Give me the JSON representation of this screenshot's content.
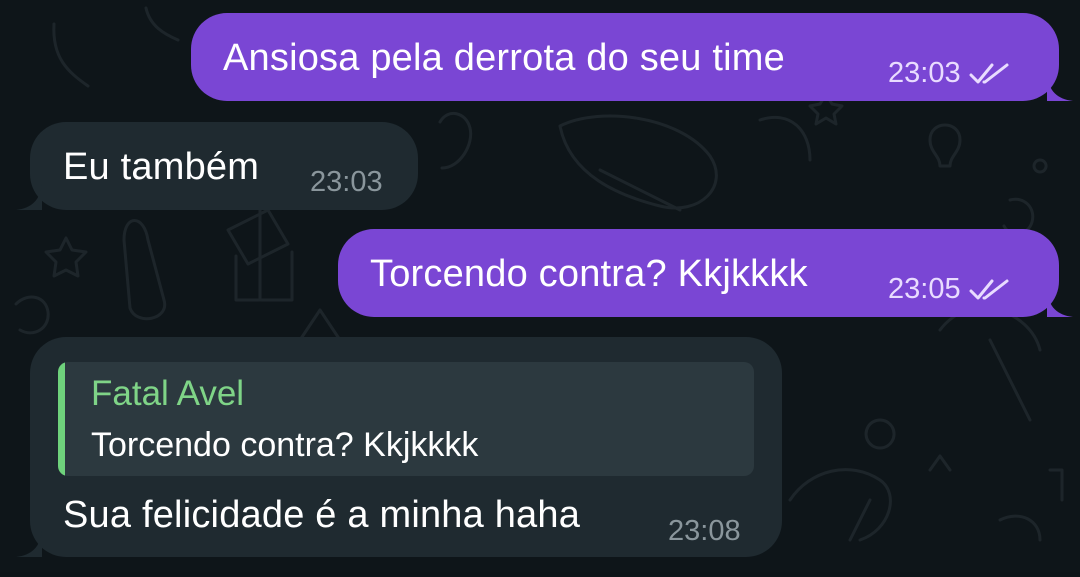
{
  "chat": {
    "messages": [
      {
        "direction": "outgoing",
        "text": "Ansiosa pela derrota do seu time",
        "time": "23:03",
        "status_icon": "double-check-icon"
      },
      {
        "direction": "incoming",
        "text": "Eu também",
        "time": "23:03"
      },
      {
        "direction": "outgoing",
        "text": "Torcendo contra? Kkjkkkk",
        "time": "23:05",
        "status_icon": "double-check-icon"
      },
      {
        "direction": "incoming",
        "reply_to": {
          "name": "Fatal Avel",
          "text": "Torcendo contra? Kkjkkkk"
        },
        "text": "Sua felicidade é a minha haha",
        "time": "23:08"
      }
    ]
  },
  "colors": {
    "background": "#0e1519",
    "outgoing_bubble": "#7a46d4",
    "incoming_bubble": "#1f2a30",
    "reply_accent": "#6fd27c"
  }
}
